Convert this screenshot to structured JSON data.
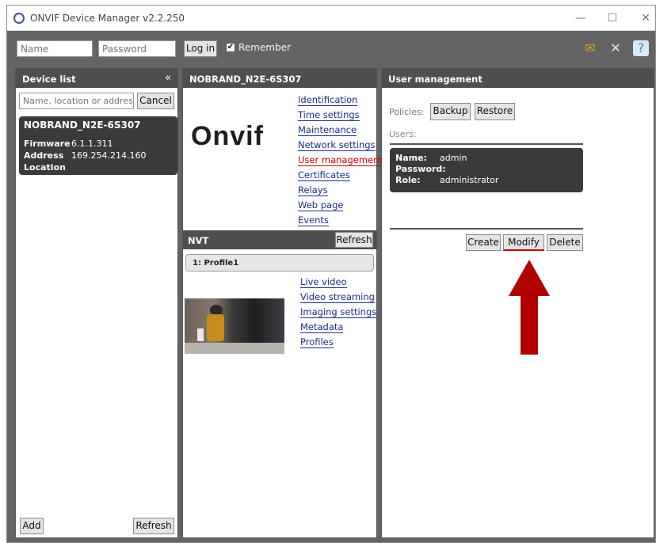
{
  "window": {
    "title": "ONVIF Device Manager v2.2.250",
    "controls": {
      "minimize": "—",
      "maximize": "☐",
      "close": "✕"
    }
  },
  "login": {
    "name_placeholder": "Name",
    "password_placeholder": "Password",
    "login_label": "Log in",
    "remember_label": "Remember",
    "remember_checked": true
  },
  "toolbar_icons": [
    "sync-icon",
    "tools-icon",
    "help-icon"
  ],
  "device_list": {
    "title": "Device list",
    "collapse_glyph": "«",
    "search_placeholder": "Name, location or address",
    "cancel_label": "Cancel",
    "device": {
      "name": "NOBRAND_N2E-6S307",
      "firmware_label": "Firmware",
      "firmware": "6.1.1.311",
      "address_label": "Address",
      "address": "169.254.214.160",
      "location_label": "Location"
    },
    "add_label": "Add",
    "refresh_label": "Refresh"
  },
  "device_panel": {
    "title": "NOBRAND_N2E-6S307",
    "logo_text": "Onvif",
    "links": [
      "Identification",
      "Time settings",
      "Maintenance",
      "Network settings",
      "User management",
      "Certificates",
      "Relays",
      "Web page",
      "Events"
    ],
    "active_link": "User management",
    "nvt": {
      "title": "NVT",
      "refresh_label": "Refresh",
      "profile_label": "1: Profile1",
      "profile_links": [
        "Live video",
        "Video streaming",
        "Imaging settings",
        "Metadata",
        "Profiles"
      ]
    }
  },
  "user_management": {
    "title": "User management",
    "policies_label": "Policies:",
    "backup_label": "Backup",
    "restore_label": "Restore",
    "users_label": "Users:",
    "user": {
      "name_label": "Name:",
      "name": "admin",
      "password_label": "Password:",
      "role_label": "Role:",
      "role": "administrator"
    },
    "create_label": "Create",
    "modify_label": "Modify",
    "delete_label": "Delete"
  },
  "colors": {
    "panel_header": "#4e4e4e",
    "card_bg": "#3a3a3a",
    "link": "#1a2e8c",
    "active_link": "#cc0000",
    "arrow": "#b00000"
  }
}
